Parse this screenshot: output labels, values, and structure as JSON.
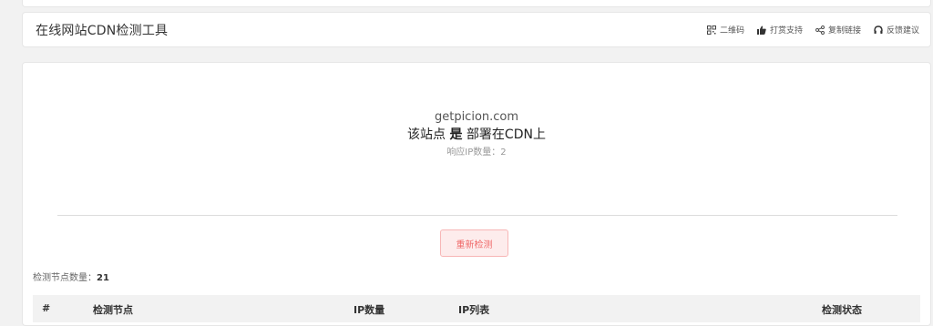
{
  "header": {
    "title": "在线网站CDN检测工具",
    "actions": [
      {
        "icon": "qrcode-icon",
        "label": "二维码"
      },
      {
        "icon": "thumbs-up-icon",
        "label": "打赏支持"
      },
      {
        "icon": "share-icon",
        "label": "复制链接"
      },
      {
        "icon": "feedback-icon",
        "label": "反馈建议"
      }
    ]
  },
  "result": {
    "domain": "getpicion.com",
    "status_prefix": "该站点",
    "status_bold": "是",
    "status_suffix": "部署在CDN上",
    "ip_count_label": "响应IP数量：",
    "ip_count_value": "2"
  },
  "retest_label": "重新检测",
  "node_count": {
    "label": "检测节点数量：",
    "value": "21"
  },
  "table": {
    "columns": [
      "#",
      "检测节点",
      "IP数量",
      "IP列表",
      "检测状态"
    ]
  },
  "colors": {
    "retest_text": "#f06a6a",
    "retest_bg": "#fdecec",
    "retest_border": "#f7b6b6",
    "background": "#f2f2f2"
  }
}
